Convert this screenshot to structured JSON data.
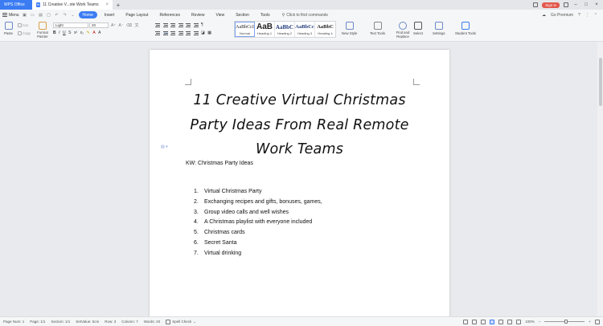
{
  "titlebar": {
    "app_tab": "WPS Office",
    "doc_tab": "11 Creative V...ote Work Teams",
    "signin": "Sign in",
    "go_premium": "Go Premium"
  },
  "menubar": {
    "menu_label": "Menu",
    "tabs": [
      "Home",
      "Insert",
      "Page Layout",
      "References",
      "Review",
      "View",
      "Section",
      "Tools"
    ],
    "active_tab": "Home",
    "search_placeholder": "Click to find commands"
  },
  "ribbon": {
    "paste": "Paste",
    "cut": "Cut",
    "copy": "Copy",
    "format_painter": "Format Painter",
    "font_name": "Light",
    "font_size": "20",
    "styles": [
      {
        "preview": "AaBbCcI",
        "label": "Normal"
      },
      {
        "preview": "AaB",
        "label": "Heading 1"
      },
      {
        "preview": "AaBbC",
        "label": "Heading 2"
      },
      {
        "preview": "AaBbCc",
        "label": "Heading 3"
      },
      {
        "preview": "AaBbC",
        "label": "Heading 4"
      }
    ],
    "new_style": "New Style",
    "text_tools": "Text Tools",
    "find_replace": "Find and Replace",
    "select": "Select",
    "settings": "Settings",
    "student_tools": "Student Tools"
  },
  "document": {
    "title": "11 Creative Virtual Christmas Party Ideas From Real Remote Work Teams",
    "keyword": "KW: Christmas Party Ideas",
    "list": [
      {
        "num": "1.",
        "text": "Virtual Christmas Party"
      },
      {
        "num": "2.",
        "text": "Exchanging recipes and gifts, bonuses, games,"
      },
      {
        "num": "3.",
        "text": "Group video calls and well wishes"
      },
      {
        "num": "4.",
        "text": "A Christmas playlist with everyone included"
      },
      {
        "num": "5.",
        "text": "Christmas cards"
      },
      {
        "num": "6.",
        "text": "Secret Santa"
      },
      {
        "num": "7.",
        "text": "Virtual drinking"
      }
    ]
  },
  "statusbar": {
    "page_num": "Page Num: 1",
    "page": "Page: 1/1",
    "section": "Section: 1/1",
    "set_value": "SetValue: 5cm",
    "row": "Row: 3",
    "column": "Column: 7",
    "words": "Words: 40",
    "spell_check": "Spell Check",
    "zoom": "100%"
  }
}
